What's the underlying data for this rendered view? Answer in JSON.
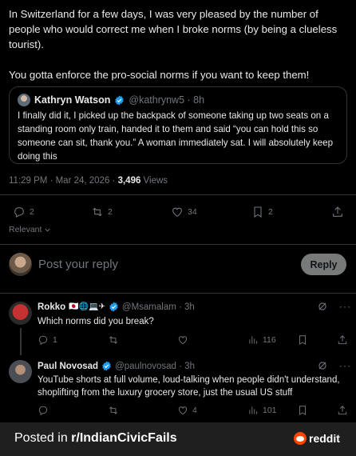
{
  "post": {
    "text": "In Switzerland for a few days, I was very pleased by the number of people who would correct me when I broke norms (by being a clueless tourist).\n\nYou gotta enforce the pro-social norms if you want to keep them!",
    "timestamp": "11:29 PM · Mar 24, 2026 · ",
    "views_count": "3,496",
    "views_label": " Views",
    "replies": "2",
    "reposts": "2",
    "likes": "34",
    "bookmarks": "2"
  },
  "quote": {
    "name": "Kathryn Watson",
    "handle": "@kathrynw5 · 8h",
    "text": "I finally did it, I picked up the backpack of someone taking up two seats on a standing room only train, handed it to them and said “you can hold this so someone can sit, thank you.” A woman immediately sat. I will absolutely keep doing this"
  },
  "sort": {
    "label": "Relevant"
  },
  "compose": {
    "placeholder": "Post your reply",
    "button": "Reply"
  },
  "replies": [
    {
      "name": "Rokko",
      "flags": "🇯🇵🌐💻✈",
      "handle": "@Msamalam · 3h",
      "text": "Which norms did you break?",
      "reply_count": "1",
      "repost_count": "",
      "like_count": "",
      "views": "116"
    },
    {
      "name": "Paul Novosad",
      "flags": "",
      "handle": "@paulnovosad · 3h",
      "text": "YouTube shorts at full volume, loud-talking when people didn't understand, shoplifting from the luxury grocery store, just the usual US stuff",
      "reply_count": "",
      "repost_count": "",
      "like_count": "4",
      "views": "101"
    }
  ],
  "footer": {
    "prefix": "Posted in ",
    "subreddit": "r/IndianCivicFails",
    "brand": "reddit"
  },
  "colors": {
    "background": "#000000",
    "text": "#e7e9ea",
    "muted": "#71767b",
    "verified": "#1d9bf0",
    "reddit": "#ff4500"
  }
}
